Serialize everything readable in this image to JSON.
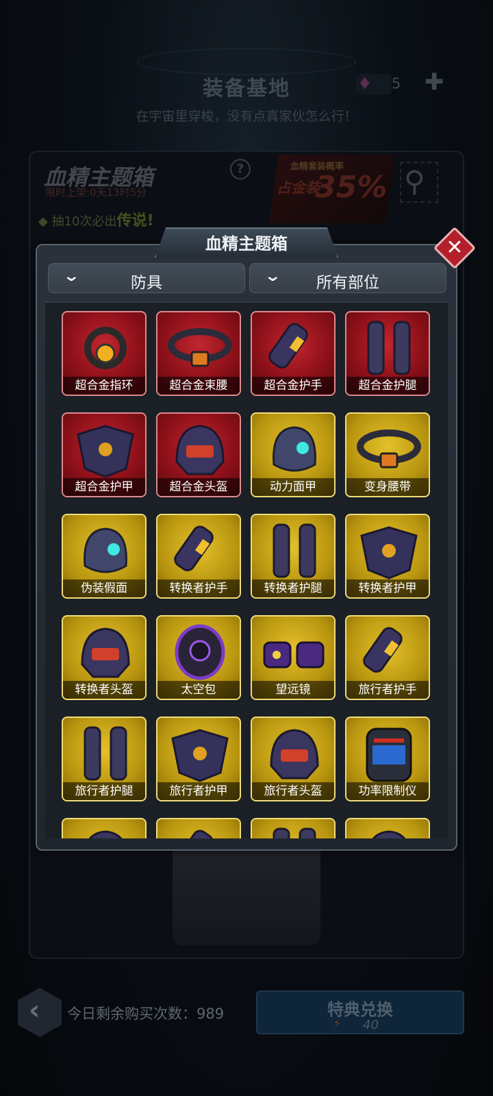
{
  "background": {
    "title": "装备基地",
    "subtitle": "在宇宙里穿梭，没有点真家伙怎么行！",
    "gem_count": "5",
    "card_title": "血精主题箱",
    "card_timer": "限时上架:0天13时5分",
    "help": "?",
    "notice_prefix": "◆ 抽10次必出",
    "notice_highlight": "传说!",
    "promo_top": "血精套装概率",
    "promo_text": "占金装",
    "promo_pct": "35%",
    "daily_purchases": "今日剩余购买次数：989",
    "redeem_label": "特典兑换",
    "redeem_cost": "40"
  },
  "modal": {
    "title": "血精主题箱",
    "filter_type": "防具",
    "filter_slot": "所有部位"
  },
  "items": [
    {
      "name": "超合金指环",
      "rarity": "red",
      "icon": "ring-icon"
    },
    {
      "name": "超合金束腰",
      "rarity": "red",
      "icon": "belt-icon"
    },
    {
      "name": "超合金护手",
      "rarity": "red",
      "icon": "gauntlet-icon"
    },
    {
      "name": "超合金护腿",
      "rarity": "red",
      "icon": "leg-armor-icon"
    },
    {
      "name": "超合金护甲",
      "rarity": "red",
      "icon": "chest-armor-icon"
    },
    {
      "name": "超合金头盔",
      "rarity": "red",
      "icon": "helmet-icon"
    },
    {
      "name": "动力面甲",
      "rarity": "gold",
      "icon": "mask-icon"
    },
    {
      "name": "变身腰带",
      "rarity": "gold",
      "icon": "belt-icon"
    },
    {
      "name": "伪装假面",
      "rarity": "gold",
      "icon": "mask-icon"
    },
    {
      "name": "转换者护手",
      "rarity": "gold",
      "icon": "gauntlet-icon"
    },
    {
      "name": "转换者护腿",
      "rarity": "gold",
      "icon": "leg-armor-icon"
    },
    {
      "name": "转换者护甲",
      "rarity": "gold",
      "icon": "chest-armor-icon"
    },
    {
      "name": "转换者头盔",
      "rarity": "gold",
      "icon": "helmet-icon"
    },
    {
      "name": "太空包",
      "rarity": "gold",
      "icon": "backpack-icon"
    },
    {
      "name": "望远镜",
      "rarity": "gold",
      "icon": "binoculars-icon"
    },
    {
      "name": "旅行者护手",
      "rarity": "gold",
      "icon": "gauntlet-icon"
    },
    {
      "name": "旅行者护腿",
      "rarity": "gold",
      "icon": "leg-armor-icon"
    },
    {
      "name": "旅行者护甲",
      "rarity": "gold",
      "icon": "chest-armor-icon"
    },
    {
      "name": "旅行者头盔",
      "rarity": "gold",
      "icon": "helmet-icon"
    },
    {
      "name": "功率限制仪",
      "rarity": "gold",
      "icon": "limiter-icon"
    },
    {
      "name": "",
      "rarity": "gold",
      "icon": "helmet-icon"
    },
    {
      "name": "",
      "rarity": "gold",
      "icon": "gauntlet-icon"
    },
    {
      "name": "",
      "rarity": "gold",
      "icon": "leg-armor-icon"
    },
    {
      "name": "",
      "rarity": "gold",
      "icon": "helmet-icon"
    }
  ],
  "colors": {
    "rarity_red": "#a81620",
    "rarity_gold": "#d4b01c",
    "close_button": "#b3202a"
  }
}
